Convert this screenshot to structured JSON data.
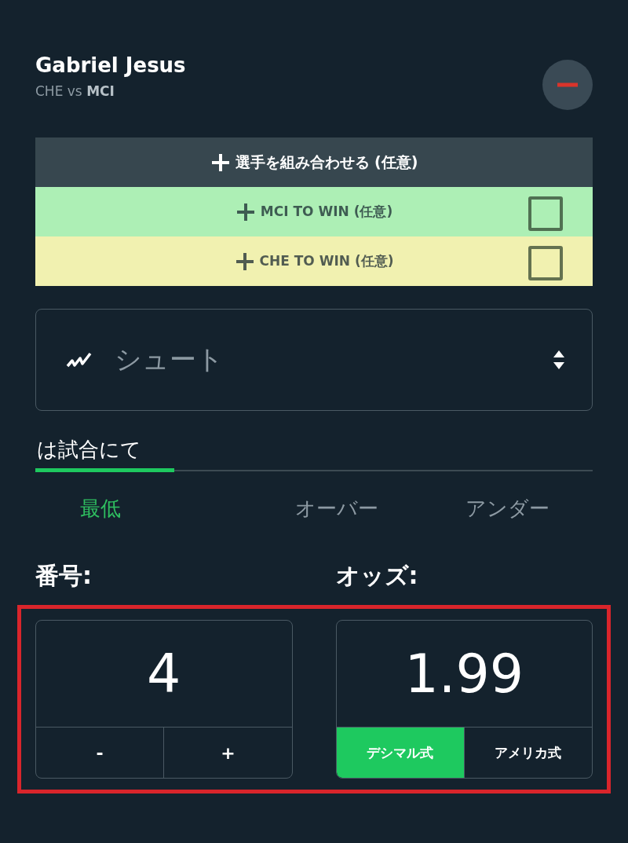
{
  "player": {
    "name": "Gabriel Jesus",
    "match": "CHE vs **MCI**"
  },
  "combos": [
    {
      "kind": "header",
      "label": "選手を組み合わせる (任意)"
    },
    {
      "kind": "team",
      "label": "MCI TO WIN (任意)",
      "color": "#adefb5",
      "checked": false
    },
    {
      "kind": "team",
      "label": "CHE TO WIN (任意)",
      "color": "#f1f1b0",
      "checked": false
    }
  ],
  "stat_select": {
    "value": "シュート"
  },
  "scope_tabs": [
    {
      "label": "は試合にて",
      "selected": true
    }
  ],
  "line_options": [
    {
      "label": "最低",
      "selected": true
    },
    {
      "label": "オーバー",
      "selected": false
    },
    {
      "label": "アンダー",
      "selected": false
    }
  ],
  "number": {
    "label": "番号:",
    "value": "4",
    "buttons": [
      "-",
      "+"
    ]
  },
  "odds": {
    "label": "オッズ:",
    "value": "1.99",
    "formats": [
      {
        "label": "デシマル式",
        "selected": true
      },
      {
        "label": "アメリカ式",
        "selected": false
      }
    ]
  }
}
